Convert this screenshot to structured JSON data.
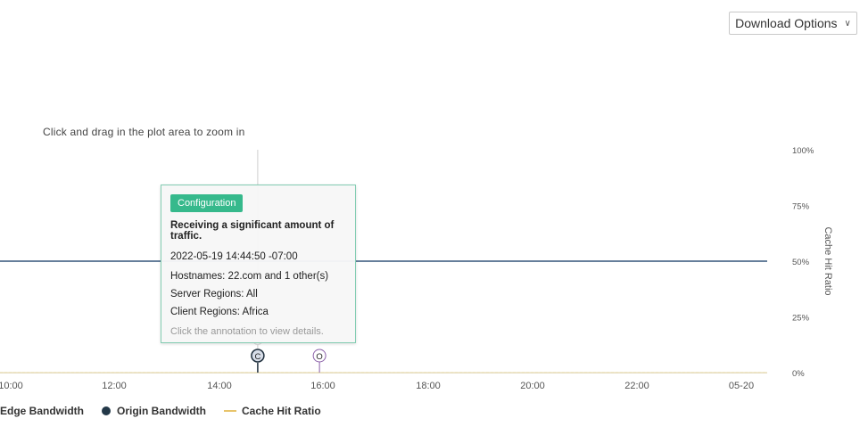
{
  "toolbar": {
    "download_label": "Download Options",
    "download_icon": "chevron-down-icon"
  },
  "chart_hint": "Click and drag in the plot area to zoom in",
  "chart_data": {
    "type": "line",
    "x_ticks": [
      "10:00",
      "12:00",
      "14:00",
      "16:00",
      "18:00",
      "20:00",
      "22:00",
      "05-20"
    ],
    "y2_label": "Cache Hit Ratio",
    "y2_ticks": [
      "100%",
      "75%",
      "50%",
      "25%",
      "0%"
    ],
    "y2_lim": [
      0,
      100
    ],
    "series": [
      {
        "name": "Edge Bandwidth",
        "color": "#3d6690",
        "style": "dashed",
        "x": [
          "10:00",
          "05-20"
        ],
        "y": [
          0,
          0
        ]
      },
      {
        "name": "Origin Bandwidth",
        "color": "#233848",
        "style": "solid",
        "x": [
          "10:00",
          "05-20"
        ],
        "y": [
          0,
          0
        ]
      },
      {
        "name": "Cache Hit Ratio",
        "color": "#e8c46b",
        "style": "solid",
        "axis": "right",
        "x": [
          "10:00",
          "05-20"
        ],
        "y": [
          50,
          50
        ]
      }
    ],
    "annotations": [
      {
        "label": "C",
        "time": "14:44:50",
        "color": "#233848",
        "active": true
      },
      {
        "label": "O",
        "time": "15:55",
        "color": "#8a5fa8",
        "active": false
      }
    ]
  },
  "tooltip": {
    "badge": "Configuration",
    "headline": "Receiving a significant amount of traffic.",
    "timestamp": "2022-05-19 14:44:50 -07:00",
    "hostnames": "Hostnames: 22.com and 1 other(s)",
    "server_regions": "Server Regions: All",
    "client_regions": "Client Regions: Africa",
    "hint": "Click the annotation to view details."
  },
  "legend": {
    "edge": "Edge Bandwidth",
    "origin": "Origin Bandwidth",
    "cache": "Cache Hit Ratio"
  }
}
